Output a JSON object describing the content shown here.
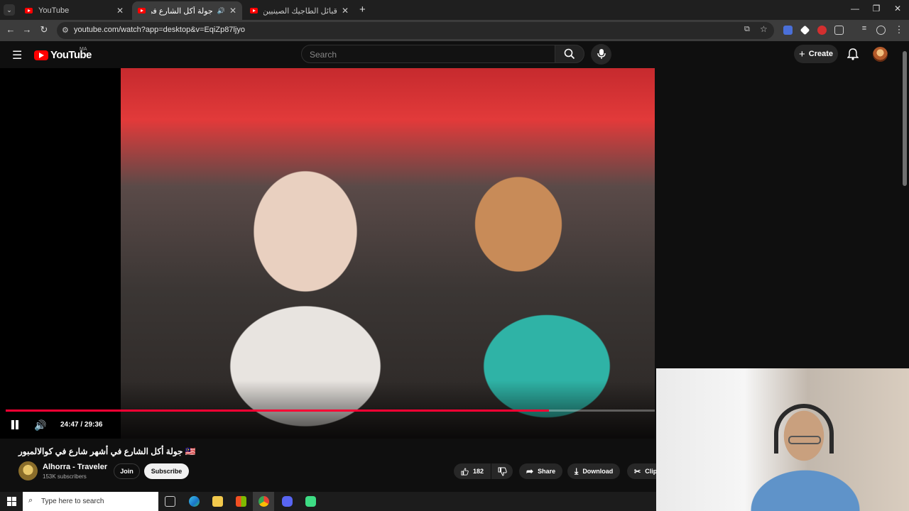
{
  "browser": {
    "tabs": [
      {
        "title": "YouTube",
        "active": false
      },
      {
        "title": "جولة أكل الشارع في أشهر شا",
        "active": true
      },
      {
        "title": "قبائل الطاجيك الصينيين | مسلمو...",
        "active": false
      }
    ],
    "new_tab": "+",
    "window_controls": {
      "minimize": "—",
      "restore": "❐",
      "close": "✕"
    },
    "url": "youtube.com/watch?app=desktop&v=EqiZp87ljyo"
  },
  "youtube": {
    "logo_text": "YouTube",
    "country_code": "MA",
    "search_placeholder": "Search",
    "create_label": "Create",
    "accent": "#ff0000"
  },
  "player": {
    "time": "24:47 / 29:36",
    "progress": 0.837,
    "progress_color": "#ff0033"
  },
  "video": {
    "title": "جولة أكل الشارع في أشهر شارع في كوالالمبور 🇲🇾",
    "channel": "Alhorra - Traveler",
    "subscribers": "153K subscribers",
    "join_label": "Join",
    "subscribe_label": "Subscribe",
    "likes": "182",
    "share_label": "Share",
    "download_label": "Download",
    "clip_label": "Clip"
  },
  "taskbar": {
    "search_placeholder": "Type here to search"
  }
}
